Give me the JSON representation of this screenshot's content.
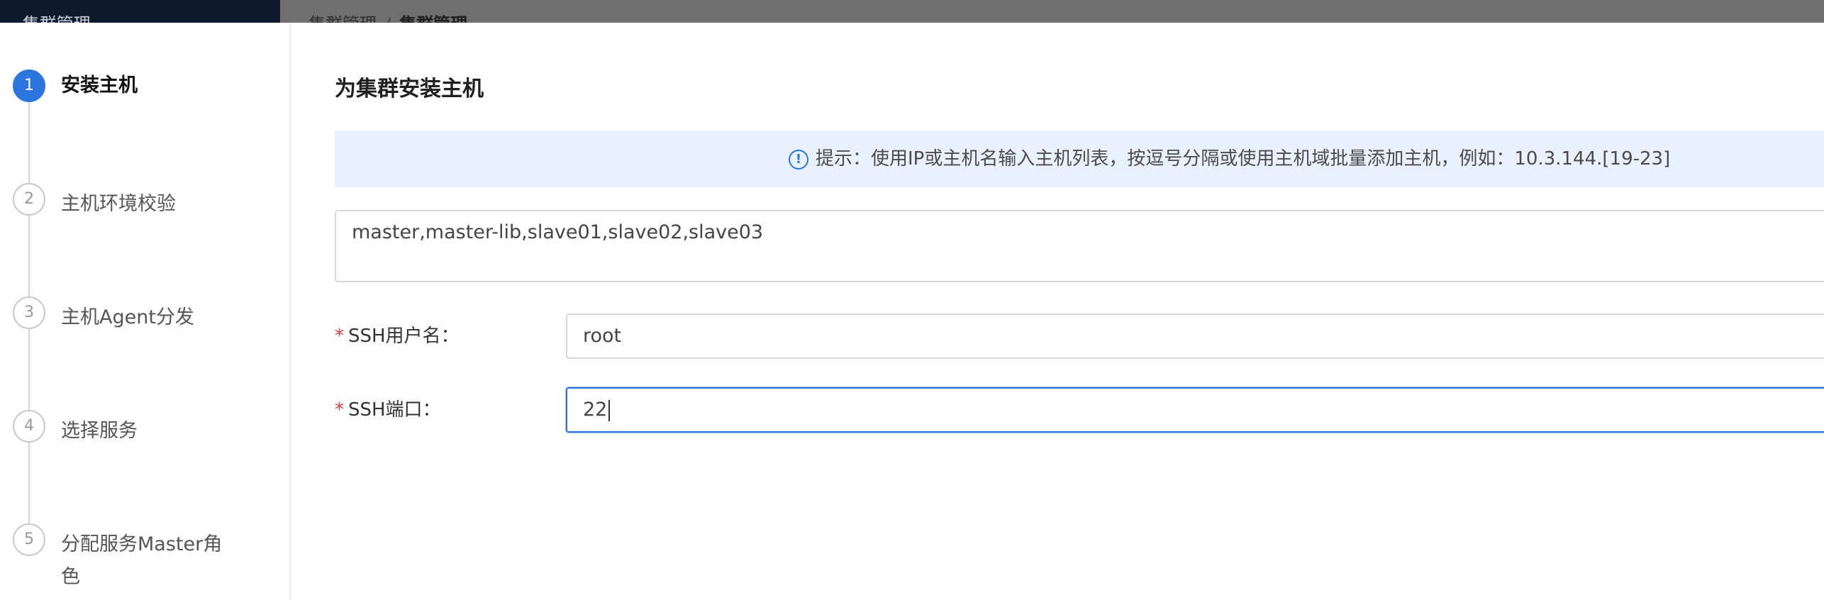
{
  "background": {
    "app_title": "—  集群管理",
    "breadcrumb": [
      "集群管理",
      "集群管理"
    ],
    "breadcrumb_separator": "/"
  },
  "steps": [
    {
      "number": "1",
      "label": "安装主机",
      "active": true
    },
    {
      "number": "2",
      "label": "主机环境校验",
      "active": false
    },
    {
      "number": "3",
      "label": "主机Agent分发",
      "active": false
    },
    {
      "number": "4",
      "label": "选择服务",
      "active": false
    },
    {
      "number": "5",
      "label": "分配服务Master角色",
      "active": false
    }
  ],
  "content": {
    "title": "为集群安装主机",
    "tip": {
      "icon": "info-circle-icon",
      "text": "提示：使用IP或主机名输入主机列表，按逗号分隔或使用主机域批量添加主机，例如：10.3.144.[19-23]"
    },
    "hosts_value": "master,master-lib,slave01,slave02,slave03",
    "ssh_user": {
      "label": "SSH用户名：",
      "value": "root"
    },
    "ssh_port": {
      "label": "SSH端口：",
      "value": "22"
    }
  },
  "colors": {
    "accent": "#2a76de",
    "tip_background": "#e8f1fd",
    "required_mark": "#e03a3a"
  }
}
